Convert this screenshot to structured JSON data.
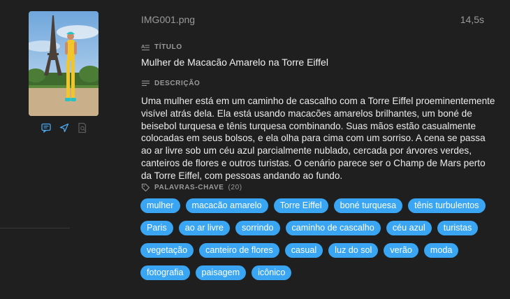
{
  "file": {
    "name": "IMG001.png",
    "duration": "14,5s"
  },
  "thumbnail_actions": [
    "comment-icon",
    "send-icon",
    "document-search-icon"
  ],
  "title_section": {
    "label": "TÍTULO",
    "value": "Mulher de Macacão Amarelo na Torre Eiffel"
  },
  "description_section": {
    "label": "DESCRIÇÃO",
    "value": "Uma mulher está em um caminho de cascalho com a Torre Eiffel proeminentemente visível atrás dela. Ela está usando macacões amarelos brilhantes, um boné de beisebol turquesa e tênis turquesa combinando. Suas mãos estão casualmente colocadas em seus bolsos, e ela olha para cima com um sorriso. A cena se passa ao ar livre sob um céu azul parcialmente nublado, cercada por árvores verdes, canteiros de flores e outros turistas. O cenário parece ser o Champ de Mars perto da Torre Eiffel, com pessoas andando ao fundo."
  },
  "keywords_section": {
    "label": "PALAVRAS-CHAVE",
    "count": "(20)",
    "tags": [
      "mulher",
      "macacão amarelo",
      "Torre Eiffel",
      "boné turquesa",
      "tênis turbulentos",
      "Paris",
      "ao ar livre",
      "sorrindo",
      "caminho de cascalho",
      "céu azul",
      "turistas",
      "vegetação",
      "canteiro de flores",
      "casual",
      "luz do sol",
      "verão",
      "moda",
      "fotografia",
      "paisagem",
      "icônico"
    ]
  },
  "colors": {
    "background": "#1f1f1f",
    "tag": "#3aa6f3",
    "muted": "#9a9a9a"
  }
}
